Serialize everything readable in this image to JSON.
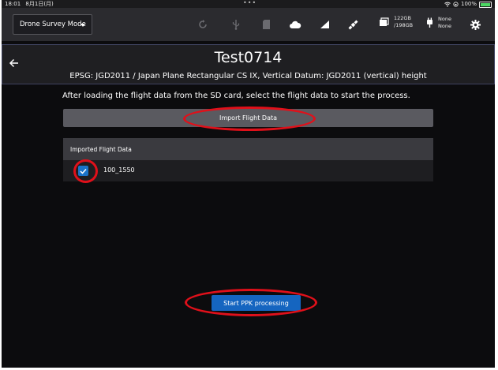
{
  "statusbar": {
    "time": "18:01",
    "date": "8月1日(月)",
    "dots": "•••",
    "battery_percent": "100%"
  },
  "toolbar": {
    "mode_label": "Drone Survey Mode",
    "icons": [
      "refresh-icon",
      "usb-icon",
      "sd-card-icon",
      "cloud-icon",
      "signal-icon",
      "satellite-icon",
      "storage-icon",
      "battery-plug-icon",
      "gear-icon"
    ],
    "storage_used": "122GB",
    "storage_total": "/198GB",
    "battery_line1": "None",
    "battery_line2": "None"
  },
  "header": {
    "title": "Test0714",
    "subtitle": "EPSG: JGD2011 / Japan Plane Rectangular CS IX, Vertical Datum: JGD2011 (vertical) height"
  },
  "main": {
    "instruction": "After loading the flight data from the SD card, select the flight data to start the process.",
    "import_button": "Import Flight Data",
    "list_header": "Imported Flight Data",
    "items": [
      {
        "label": "100_1550",
        "checked": true
      }
    ],
    "ppk_button": "Start PPK processing"
  },
  "colors": {
    "annotation": "#e0101a",
    "primary_button": "#1565c0",
    "background": "#0c0c0e"
  }
}
